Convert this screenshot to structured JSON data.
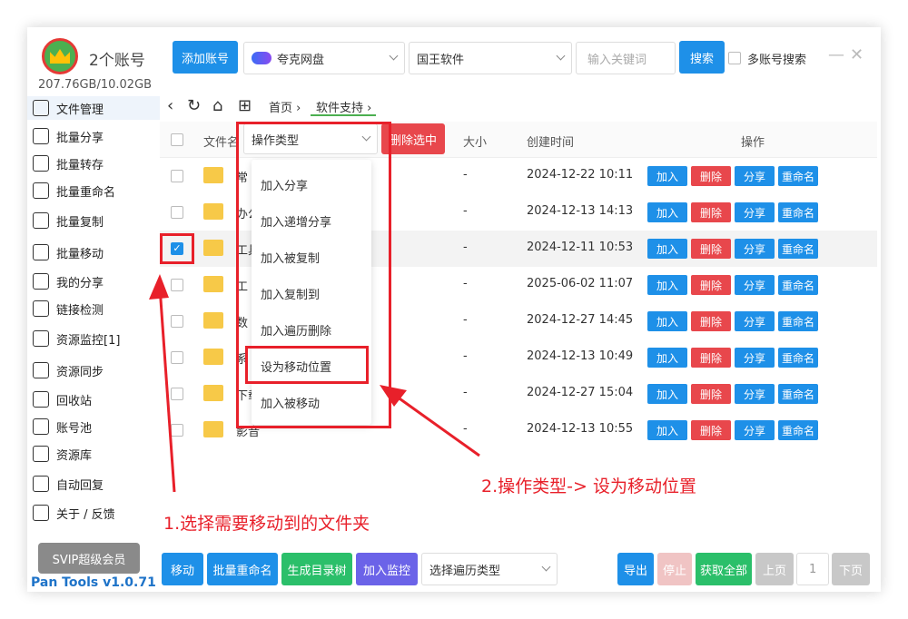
{
  "header": {
    "account_title": "2个账号",
    "storage": "207.76GB/10.02GB",
    "add_account": "添加账号",
    "drive_select": "夸克网盘",
    "folder_select": "国王软件",
    "search_placeholder": "输入关键词",
    "search_button": "搜索",
    "multi_search_label": "多账号搜索"
  },
  "sidebar": {
    "items": [
      {
        "label": "文件管理",
        "icon": "folder-icon"
      },
      {
        "label": "批量分享",
        "icon": "share-icon"
      },
      {
        "label": "批量转存",
        "icon": "transfer-icon"
      },
      {
        "label": "批量重命名",
        "icon": "rename-icon"
      },
      {
        "label": "批量复制",
        "icon": "copy-icon"
      },
      {
        "label": "批量移动",
        "icon": "move-icon"
      },
      {
        "label": "我的分享",
        "icon": "my-share-icon"
      },
      {
        "label": "链接检测",
        "icon": "link-check-icon"
      },
      {
        "label": "资源监控[1]",
        "icon": "monitor-icon"
      },
      {
        "label": "资源同步",
        "icon": "sync-icon"
      },
      {
        "label": "回收站",
        "icon": "trash-icon"
      },
      {
        "label": "账号池",
        "icon": "account-pool-icon"
      },
      {
        "label": "资源库",
        "icon": "library-icon"
      },
      {
        "label": "自动回复",
        "icon": "auto-reply-icon"
      },
      {
        "label": "关于 / 反馈",
        "icon": "bell-icon"
      }
    ],
    "svip": "SVIP超级会员",
    "version": "Pan Tools v1.0.71"
  },
  "breadcrumb": {
    "home": "首页",
    "current": "软件支持"
  },
  "table": {
    "headers": {
      "name": "文件名",
      "size": "大小",
      "created": "创建时间",
      "actions": "操作"
    },
    "op_type_placeholder": "操作类型",
    "delete_selected": "删除选中",
    "row_buttons": {
      "add": "加入",
      "delete": "删除",
      "share": "分享",
      "rename": "重命名"
    },
    "rows": [
      {
        "name": "常",
        "size": "-",
        "date": "2024-12-22 10:11",
        "checked": false
      },
      {
        "name": "办公",
        "size": "-",
        "date": "2024-12-13 14:13",
        "checked": false
      },
      {
        "name": "工具",
        "size": "-",
        "date": "2024-12-11 10:53",
        "checked": true
      },
      {
        "name": "工",
        "size": "-",
        "date": "2025-06-02 11:07",
        "checked": false
      },
      {
        "name": "数",
        "size": "-",
        "date": "2024-12-27 14:45",
        "checked": false
      },
      {
        "name": "系",
        "size": "-",
        "date": "2024-12-13 10:49",
        "checked": false
      },
      {
        "name": "下载",
        "size": "-",
        "date": "2024-12-27 15:04",
        "checked": false
      },
      {
        "name": "影音",
        "size": "-",
        "date": "2024-12-13 10:55",
        "checked": false
      }
    ]
  },
  "dropdown": {
    "options": [
      "加入分享",
      "加入递增分享",
      "加入被复制",
      "加入复制到",
      "加入遍历删除",
      "设为移动位置",
      "加入被移动"
    ],
    "highlighted": "设为移动位置"
  },
  "annotations": {
    "step1": "1.选择需要移动到的文件夹",
    "step2": "2.操作类型-> 设为移动位置"
  },
  "footer": {
    "move": "移动",
    "batch_rename": "批量重命名",
    "gen_tree": "生成目录树",
    "add_monitor": "加入监控",
    "traverse_type": "选择遍历类型",
    "export": "导出",
    "stop": "停止",
    "fetch_all": "获取全部",
    "prev": "上页",
    "page": "1",
    "next": "下页"
  },
  "colors": {
    "primary": "#1e90e8",
    "danger": "#e8474c",
    "annotation": "#e8202a",
    "green": "#2bbf6a",
    "purple": "#6b63e8"
  }
}
